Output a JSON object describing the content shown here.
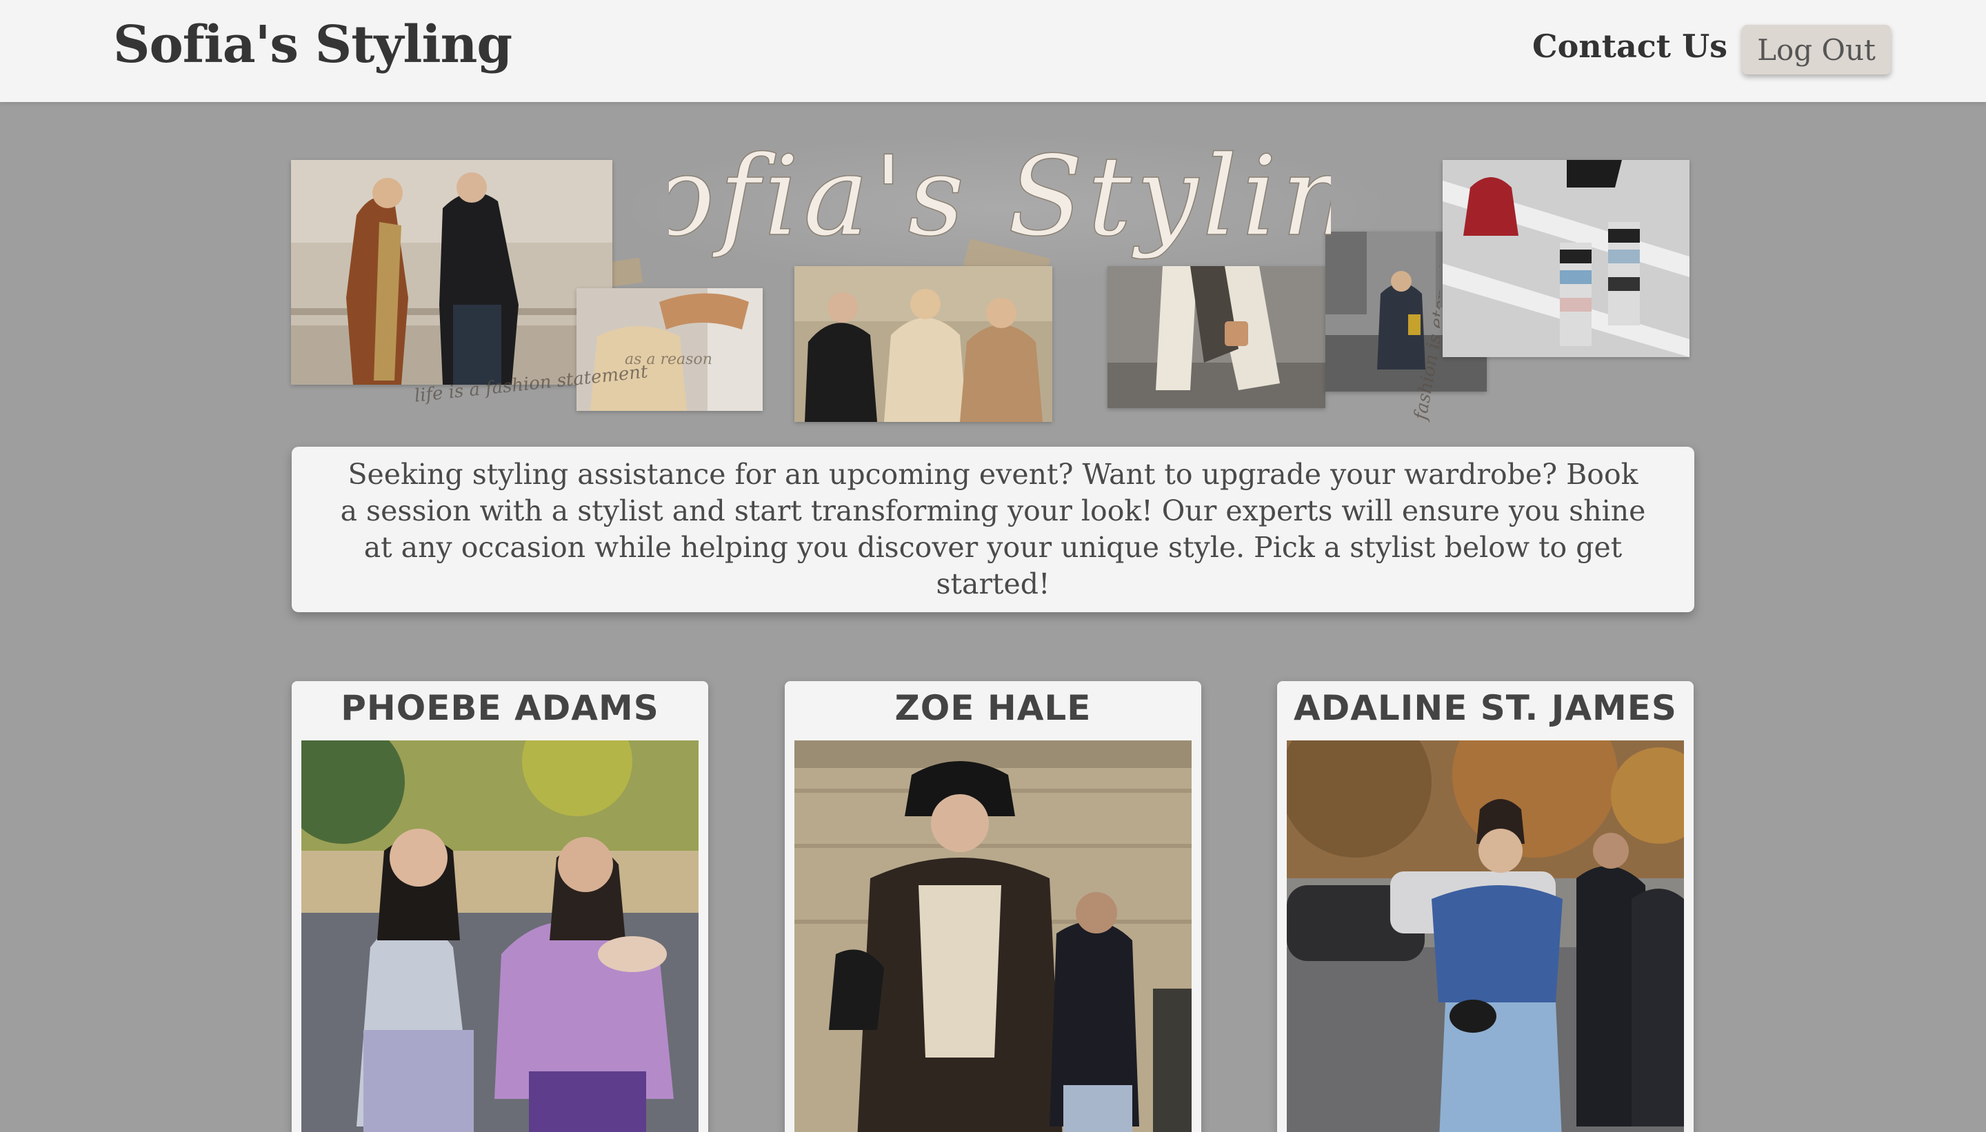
{
  "header": {
    "brand": "Sofia's Styling",
    "contact_label": "Contact Us",
    "logout_label": "Log Out"
  },
  "banner": {
    "script_title": "Sofia's Styling",
    "caption_left": "life is a fashion statement",
    "caption_right": "fashion is eternal"
  },
  "intro": {
    "text": "Seeking styling assistance for an upcoming event? Want to upgrade your wardrobe? Book a session with a stylist and start transforming your look! Our experts will ensure you shine at any occasion while helping you discover your unique style. Pick a stylist below to get started!"
  },
  "stylists": [
    {
      "name": "PHOEBE ADAMS"
    },
    {
      "name": "ZOE HALE"
    },
    {
      "name": "ADALINE ST. JAMES"
    }
  ],
  "colors": {
    "page_bg": "#9e9e9e",
    "surface": "#f4f4f4",
    "text": "#3d3d3d",
    "button_bg": "#ddd7d1"
  }
}
